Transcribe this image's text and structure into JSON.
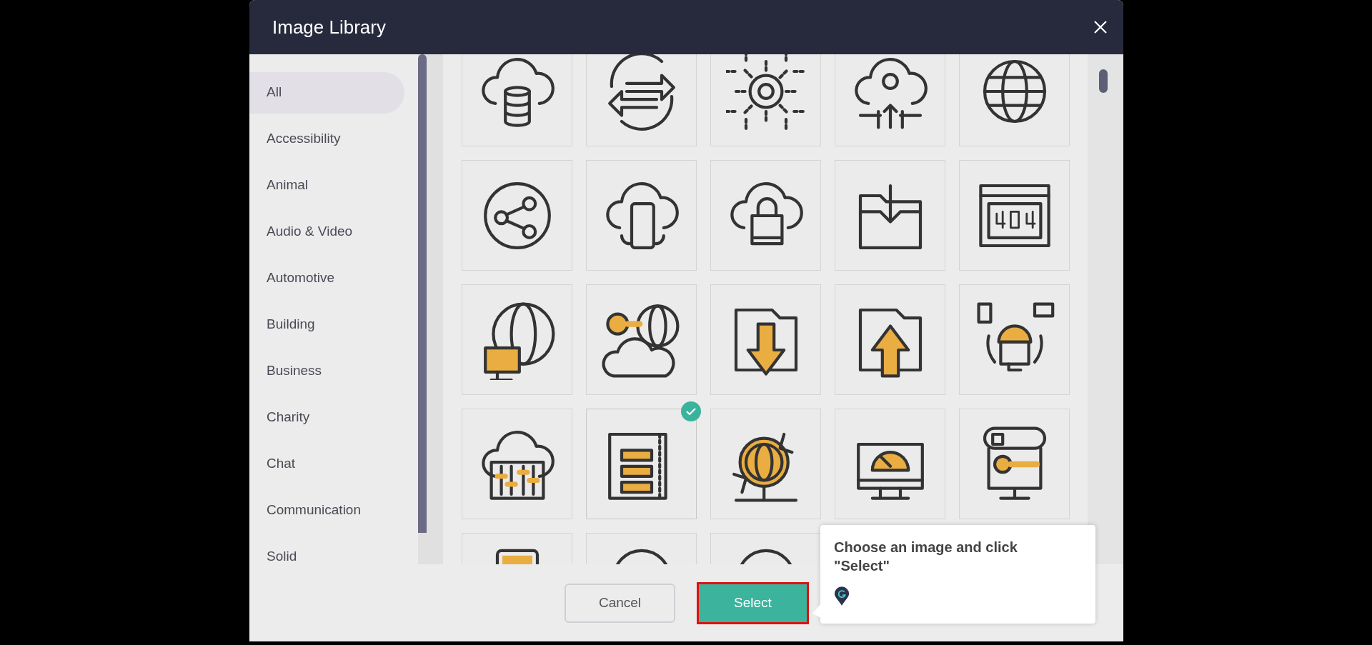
{
  "dialog": {
    "title": "Image Library"
  },
  "categories": [
    {
      "label": "All",
      "selected": true
    },
    {
      "label": "Accessibility",
      "selected": false
    },
    {
      "label": "Animal",
      "selected": false
    },
    {
      "label": "Audio & Video",
      "selected": false
    },
    {
      "label": "Automotive",
      "selected": false
    },
    {
      "label": "Building",
      "selected": false
    },
    {
      "label": "Business",
      "selected": false
    },
    {
      "label": "Charity",
      "selected": false
    },
    {
      "label": "Chat",
      "selected": false
    },
    {
      "label": "Communication",
      "selected": false
    },
    {
      "label": "Solid",
      "selected": false
    }
  ],
  "images": [
    {
      "selected": false
    },
    {
      "selected": false
    },
    {
      "selected": false
    },
    {
      "selected": false
    },
    {
      "selected": false
    },
    {
      "selected": false
    },
    {
      "selected": false
    },
    {
      "selected": false
    },
    {
      "selected": false
    },
    {
      "selected": false
    },
    {
      "selected": false
    },
    {
      "selected": false
    },
    {
      "selected": false
    },
    {
      "selected": false
    },
    {
      "selected": false
    },
    {
      "selected": false
    },
    {
      "selected": true
    },
    {
      "selected": false
    },
    {
      "selected": false
    },
    {
      "selected": false
    },
    {
      "selected": false
    },
    {
      "selected": false
    },
    {
      "selected": false
    }
  ],
  "buttons": {
    "cancel": "Cancel",
    "select": {
      "label": "Select",
      "highlighted": true
    }
  },
  "tooltip": {
    "text": "Choose an image and click \"Select\""
  }
}
